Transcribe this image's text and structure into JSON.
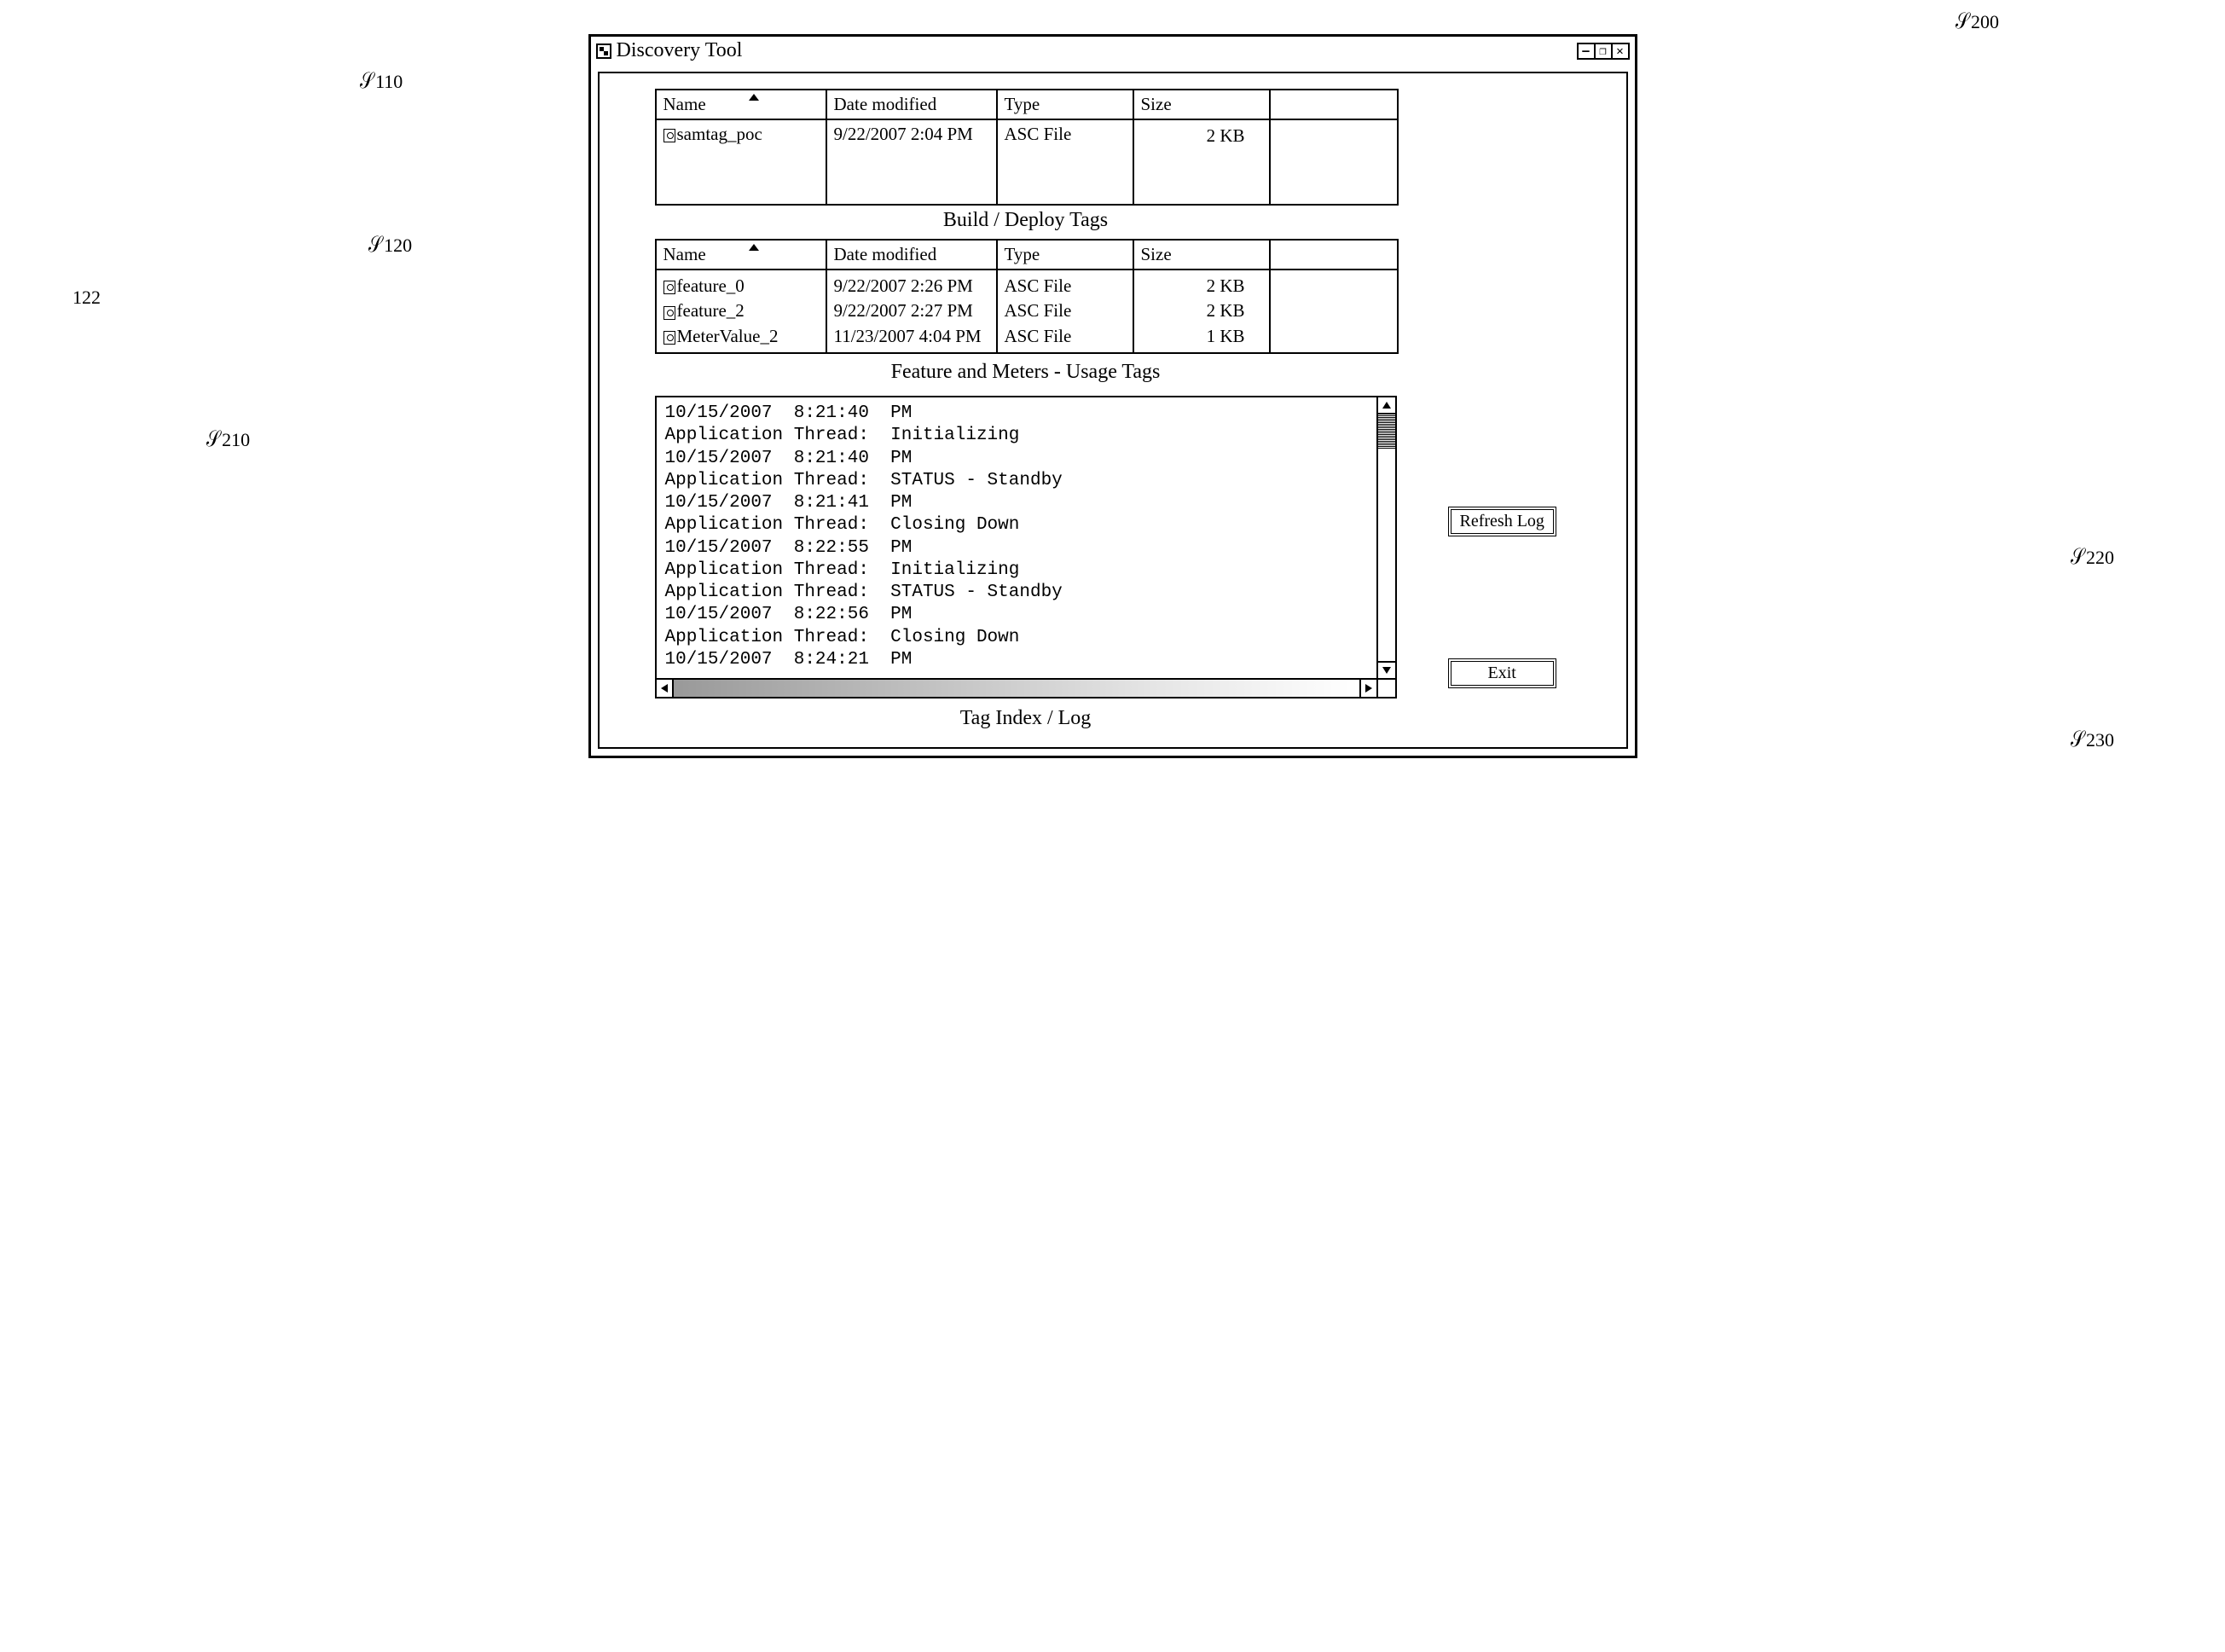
{
  "window": {
    "title": "Discovery Tool"
  },
  "callouts": {
    "c200": "200",
    "c110": "110",
    "c120": "120",
    "c122": "122",
    "c210": "210",
    "c220": "220",
    "c230": "230"
  },
  "table1": {
    "headers": {
      "name": "Name",
      "date": "Date modified",
      "type": "Type",
      "size": "Size"
    },
    "rows": [
      {
        "name": "samtag_poc",
        "date": "9/22/2007 2:04 PM",
        "type": "ASC File",
        "size": "2 KB"
      }
    ],
    "caption": "Build / Deploy Tags"
  },
  "table2": {
    "headers": {
      "name": "Name",
      "date": "Date modified",
      "type": "Type",
      "size": "Size"
    },
    "rows": [
      {
        "name": "feature_0",
        "date": "9/22/2007 2:26 PM",
        "type": "ASC File",
        "size": "2 KB"
      },
      {
        "name": "feature_2",
        "date": "9/22/2007 2:27 PM",
        "type": "ASC File",
        "size": "2 KB"
      },
      {
        "name": "MeterValue_2",
        "date": "11/23/2007 4:04 PM",
        "type": "ASC File",
        "size": "1 KB"
      }
    ],
    "caption": "Feature and Meters - Usage Tags"
  },
  "log": {
    "lines": [
      "10/15/2007  8:21:40  PM",
      "Application Thread:  Initializing",
      "10/15/2007  8:21:40  PM",
      "Application Thread:  STATUS - Standby",
      "10/15/2007  8:21:41  PM",
      "Application Thread:  Closing Down",
      "10/15/2007  8:22:55  PM",
      "Application Thread:  Initializing",
      "Application Thread:  STATUS - Standby",
      "10/15/2007  8:22:56  PM",
      "Application Thread:  Closing Down",
      "10/15/2007  8:24:21  PM"
    ],
    "caption": "Tag Index / Log"
  },
  "buttons": {
    "refresh": "Refresh Log",
    "exit": "Exit"
  }
}
